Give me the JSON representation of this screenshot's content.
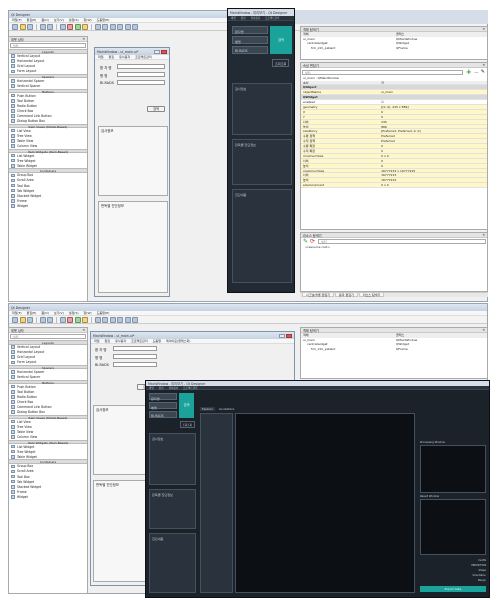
{
  "designer": {
    "title": "Qt Designer",
    "menu": [
      "파일(F)",
      "편집(E)",
      "폼(O)",
      "보기(V)",
      "설정(S)",
      "창(W)",
      "도움말(H)"
    ]
  },
  "widget_box": {
    "title": "위젯 상자",
    "filter_placeholder": "필터",
    "categories": [
      {
        "name": "Layouts",
        "items": [
          "Vertical Layout",
          "Horizontal Layout",
          "Grid Layout",
          "Form Layout"
        ]
      },
      {
        "name": "Spacers",
        "items": [
          "Horizontal Spacer",
          "Vertical Spacer"
        ]
      },
      {
        "name": "Buttons",
        "items": [
          "Push Button",
          "Tool Button",
          "Radio Button",
          "Check Box",
          "Command Link Button",
          "Dialog Button Box"
        ]
      },
      {
        "name": "Item Views (Model-Based)",
        "items": [
          "List View",
          "Tree View",
          "Table View",
          "Column View"
        ]
      },
      {
        "name": "Item Widgets (Item-Based)",
        "items": [
          "List Widget",
          "Tree Widget",
          "Table Widget"
        ]
      },
      {
        "name": "Containers",
        "items": [
          "Group Box",
          "Scroll Area",
          "Tool Box",
          "Tab Widget",
          "Stacked Widget",
          "Frame",
          "Widget"
        ]
      }
    ]
  },
  "form_top": {
    "title": "MainWindow - ui_main.ui*",
    "menu": [
      "파일",
      "편집",
      "유사용자",
      "프로젝트관리"
    ],
    "labels": [
      "환 자 명",
      "병 명",
      "BI-RADS"
    ],
    "search_btn": "검색",
    "group1": "검사정보",
    "group2": "판독별 진단정보"
  },
  "dark_top": {
    "title": "MainWindow - 미리보기 - Qt Designer",
    "menu": [
      "파일",
      "편집",
      "유사용자",
      "프로젝트관리"
    ],
    "labels": [
      "환자명",
      "병명",
      "BI-RADS"
    ],
    "search_btn": "검색",
    "small_btn": "조회조회",
    "group1": "검사정보",
    "group2": "판독별 진단정보",
    "group3": "진단내용"
  },
  "object_inspector": {
    "title": "객체 탐색기",
    "col_object": "객체",
    "col_class": "클래스",
    "rows": [
      {
        "object": "ui_main",
        "class": "QMainWindow"
      },
      {
        "object": "centralwidget",
        "class": "QWidget"
      },
      {
        "object": "frm_info_patient",
        "class": "QFrame"
      }
    ]
  },
  "property_editor": {
    "title": "속성 편집기",
    "filter_placeholder": "필터",
    "context": "ui_main : QMainWindow",
    "col_prop": "속성",
    "col_value": "값",
    "rows": [
      {
        "k": "QObject",
        "v": "",
        "sec": true
      },
      {
        "k": "objectName",
        "v": "ui_main",
        "hl": true
      },
      {
        "k": "QWidget",
        "v": "",
        "sec": true
      },
      {
        "k": "enabled",
        "v": "☑"
      },
      {
        "k": "geometry",
        "v": "[(0, 0), 245 x 889]",
        "hl": true
      },
      {
        "k": "X",
        "v": "0",
        "hl": true
      },
      {
        "k": "Y",
        "v": "0",
        "hl": true
      },
      {
        "k": "너비",
        "v": "245",
        "hl": true
      },
      {
        "k": "높이",
        "v": "889",
        "hl": true
      },
      {
        "k": "sizePolicy",
        "v": "[Preferred, Preferred, 0, 0]",
        "hl": true
      },
      {
        "k": "수평 정책",
        "v": "Preferred",
        "hl": true
      },
      {
        "k": "수직 정책",
        "v": "Preferred",
        "hl": true
      },
      {
        "k": "수평 확장",
        "v": "0",
        "hl": true
      },
      {
        "k": "수직 확장",
        "v": "0",
        "hl": true
      },
      {
        "k": "minimumSize",
        "v": "0 x 0",
        "hl": true
      },
      {
        "k": "너비",
        "v": "0",
        "hl": true
      },
      {
        "k": "높이",
        "v": "0",
        "hl": true
      },
      {
        "k": "maximumSize",
        "v": "16777215 x 16777215",
        "hl": true
      },
      {
        "k": "너비",
        "v": "16777215",
        "hl": true
      },
      {
        "k": "높이",
        "v": "16777215",
        "hl": true
      },
      {
        "k": "sizeIncrement",
        "v": "0 x 0",
        "hl": true
      }
    ]
  },
  "resource_browser": {
    "title": "리소스 탐색기",
    "filter_placeholder": "필터",
    "root": "<resource root>"
  },
  "bottom_tabs": [
    "시그널/슬롯 편집기",
    "동작 편집기",
    "리소스 탐색기"
  ],
  "form_bottom": {
    "title": "MainWindow - ui_main.ui*",
    "menu": [
      "파일",
      "편집",
      "유사용자",
      "프로젝트관리",
      "도움말",
      "레이아웃(클래스화)"
    ],
    "labels": [
      "환 자 명",
      "병 명",
      "BI-RADS"
    ],
    "search_btn": "검색",
    "group1": "검사정보",
    "group2": "판독별 진단정보",
    "right_label": "조회정보"
  },
  "object_inspector_bottom": {
    "title": "객체 탐색기",
    "col_object": "객체",
    "col_class": "클래스",
    "rows": [
      {
        "object": "ui_main",
        "class": "QMainWindow"
      },
      {
        "object": "centralwidget",
        "class": "QWidget"
      },
      {
        "object": "frm_info_patient",
        "class": "QFrame"
      }
    ],
    "prop_title": "속성 편집기",
    "context": "ui_main : QMainWindow"
  },
  "dark_bottom": {
    "title": "MainWindow - 미리보기 - Qt Designer",
    "menu": [
      "파일",
      "편집",
      "유사용자",
      "프로젝트관리"
    ],
    "labels": [
      "환자명",
      "병명",
      "BI-RADS"
    ],
    "search_btn": "검색",
    "small_btn": "조회조회",
    "group1": "검사정보",
    "group2": "판독별 진단정보",
    "group3": "진단내용",
    "tabs": [
      "Explorer",
      "Annotations"
    ],
    "right_titles": [
      "Processing Window",
      "Result Window"
    ],
    "right_fields": [
      "CLASS",
      "PREDICTION",
      "Shape",
      "Orientation",
      "Margin"
    ],
    "right_btn": "Export Data"
  }
}
